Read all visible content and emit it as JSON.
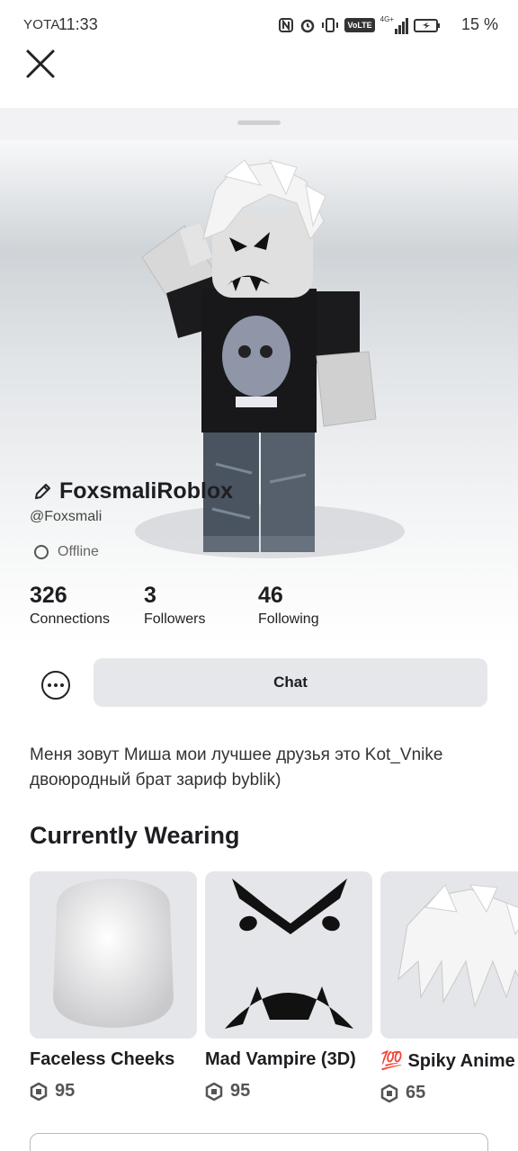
{
  "status_bar": {
    "carrier": "YOTA",
    "time": "11:33",
    "battery": "15 %",
    "icons": [
      "nfc-icon",
      "alarm-icon",
      "vibrate-icon",
      "volte-icon",
      "signal-icon",
      "battery-icon"
    ],
    "volte_label": "VoLTE",
    "network_label": "4G+"
  },
  "profile": {
    "display_name": "FoxsmaliRoblox",
    "username": "@Foxsmali",
    "presence": "Offline",
    "stats": [
      {
        "value": "326",
        "label": "Connections"
      },
      {
        "value": "3",
        "label": "Followers"
      },
      {
        "value": "46",
        "label": "Following"
      }
    ],
    "chat_label": "Chat",
    "about": "Меня зовут Миша мои лучшее друзья это Kot_Vnike двоюродный брат зариф byblik)"
  },
  "wearing": {
    "title": "Currently Wearing",
    "items": [
      {
        "name": "Faceless Cheeks",
        "price": "95"
      },
      {
        "name": "Mad Vampire (3D)",
        "price": "95"
      },
      {
        "name": "💯 Spiky Anime",
        "price": "65"
      }
    ]
  },
  "colors": {
    "accent_text": "#1e1e22",
    "button_bg": "#e6e7ea",
    "card_bg": "#e5e6e9"
  }
}
